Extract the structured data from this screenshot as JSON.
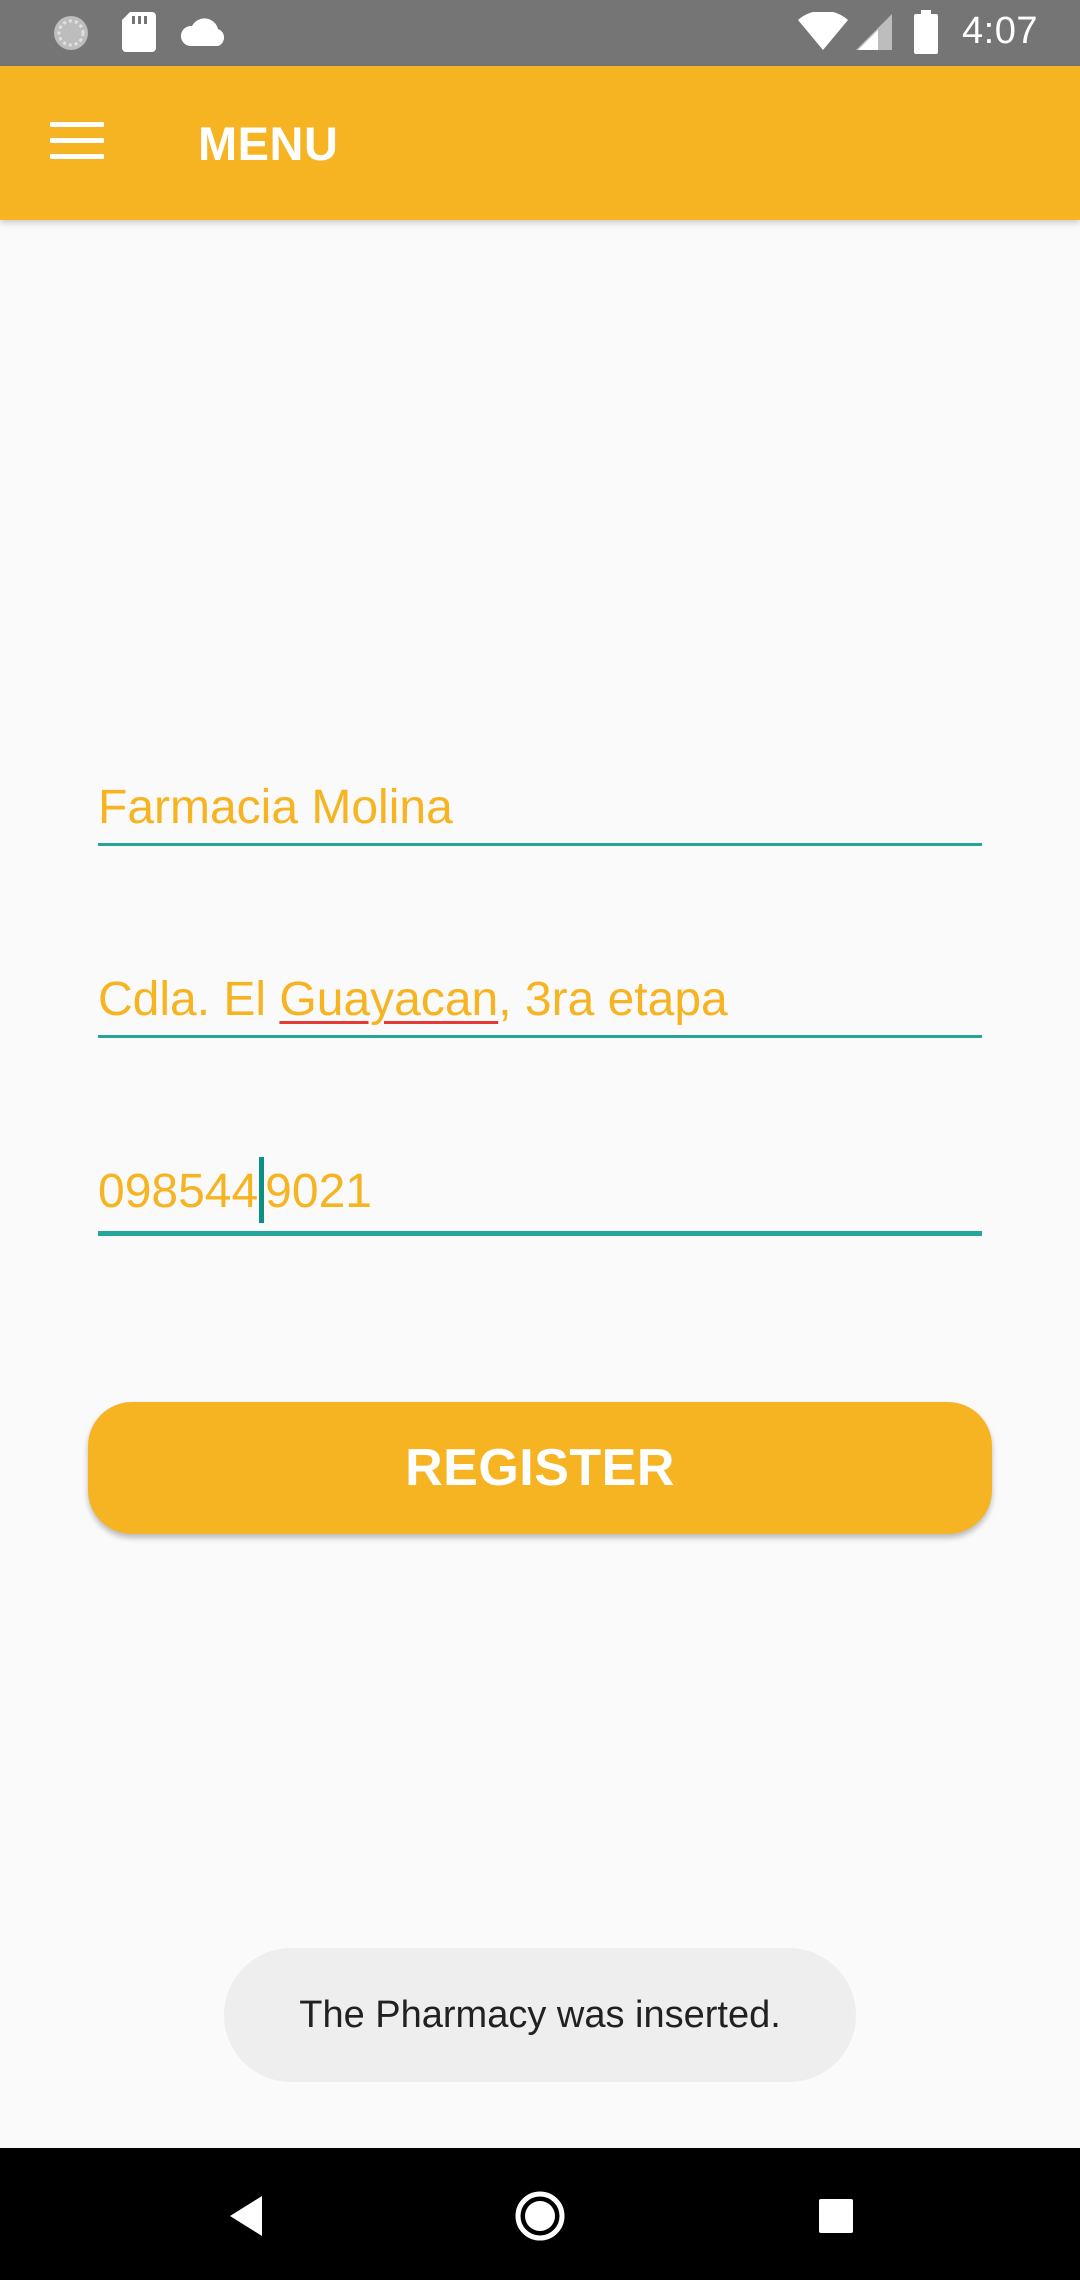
{
  "status_bar": {
    "time": "4:07",
    "icons": [
      "sync-icon",
      "sd-card-icon",
      "cloud-icon",
      "wifi-icon",
      "cell-signal-icon",
      "battery-icon"
    ]
  },
  "app_bar": {
    "title": "MENU",
    "menu_icon": "hamburger-menu-icon",
    "color": "#f7b422"
  },
  "form": {
    "name": "Farmacia Molina",
    "address_parts": [
      "Cdla. El ",
      "Guayacan",
      ", 3ra etapa"
    ],
    "phone_before_cursor": "098544",
    "phone_after_cursor": "9021",
    "field_text_color": "#f7b422",
    "underline_color": "#26a69a"
  },
  "register_button": {
    "label": "REGISTER"
  },
  "toast": {
    "message": "The Pharmacy was inserted."
  },
  "nav_bar": {
    "icons": [
      "back-icon",
      "home-icon",
      "recents-icon"
    ]
  }
}
